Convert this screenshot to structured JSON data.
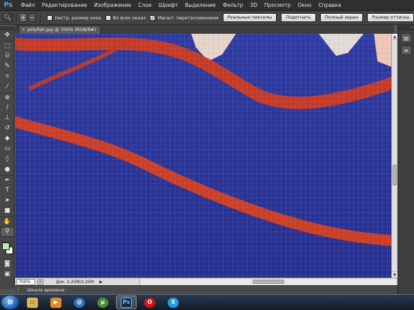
{
  "app": {
    "logo": "Ps",
    "menu": [
      "Файл",
      "Редактирование",
      "Изображение",
      "Слои",
      "Шрифт",
      "Выделение",
      "Фильтр",
      "3D",
      "Просмотр",
      "Окно",
      "Справка"
    ]
  },
  "options": {
    "tool_icon": "zoom-icon",
    "checkbox_resize_windows": "Настр. размер окон",
    "checkbox_all_windows": "Во всех окнах",
    "checkbox_scrubby_zoom": "Масшт. перетаскиванием",
    "scrubby_zoom_checked": true,
    "btn_actual_pixels": "Реальные пикселы",
    "btn_fit": "Подогнать",
    "btn_fullscreen": "Полный экран",
    "btn_print_size": "Размер оттиска"
  },
  "document": {
    "tab_title": "Jellyfish.jpg @ 700% (RGB/8#)"
  },
  "status": {
    "zoom": "700%",
    "doc_info": "Док: 2,25M/2,25M"
  },
  "timeline": {
    "label": "Шкала времени"
  },
  "tools": [
    "move-icon",
    "marquee-icon",
    "lasso-icon",
    "quick-select-icon",
    "crop-icon",
    "eyedropper-icon",
    "healing-icon",
    "brush-icon",
    "stamp-icon",
    "history-brush-icon",
    "eraser-icon",
    "gradient-icon",
    "blur-icon",
    "dodge-icon",
    "pen-icon",
    "type-icon",
    "path-select-icon",
    "shape-icon",
    "hand-icon",
    "zoom-icon"
  ],
  "colors": {
    "foreground": "#bfe8bf",
    "background": "#ffffff",
    "canvas_blue": "#2e3a9d",
    "tentacle_red": "#d9401f"
  },
  "taskbar": {
    "items": [
      "explorer-icon",
      "media-player-icon",
      "network-icon",
      "utorrent-icon",
      "photoshop-icon",
      "opera-icon",
      "skype-icon"
    ]
  }
}
